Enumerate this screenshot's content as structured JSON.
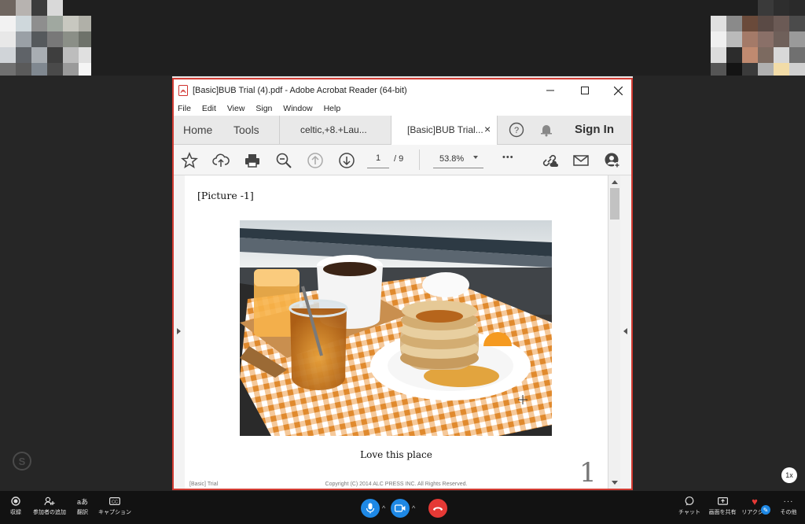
{
  "acrobat": {
    "title": "[Basic]BUB Trial (4).pdf - Adobe Acrobat Reader (64-bit)",
    "menu": [
      "File",
      "Edit",
      "View",
      "Sign",
      "Window",
      "Help"
    ],
    "tabs": {
      "home": "Home",
      "tools": "Tools",
      "doc1": "celtic,+8.+Lau...",
      "doc2": "[Basic]BUB Trial...",
      "close": "×"
    },
    "sign_in": "Sign In",
    "page_current": "1",
    "page_total": "/ 9",
    "zoom": "53.8%",
    "more": "•••"
  },
  "document": {
    "heading": "[Picture -1]",
    "caption": "Love this place",
    "page_number": "1",
    "footer_left": "[Basic] Trial",
    "footer_center": "Copyright (C) 2014 ALC PRESS INC. All Rights Reserved."
  },
  "meeting": {
    "speed_badge": "1x",
    "left_controls": [
      {
        "label": "収録",
        "icon": "record-icon"
      },
      {
        "label": "参加者の追加",
        "icon": "add-participant-icon"
      },
      {
        "label": "翻訳",
        "icon": "translate-icon"
      },
      {
        "label": "キャプション",
        "icon": "captions-icon"
      }
    ],
    "right_controls": [
      {
        "label": "チャット",
        "icon": "chat-icon"
      },
      {
        "label": "画面を共有",
        "icon": "share-screen-icon"
      },
      {
        "label": "リアクシ...",
        "icon": "reaction-icon"
      },
      {
        "label": "その他",
        "icon": "more-icon"
      }
    ],
    "colors": {
      "accent": "#1e88e5",
      "hangup": "#e53935",
      "frame": "#d23c33"
    }
  }
}
